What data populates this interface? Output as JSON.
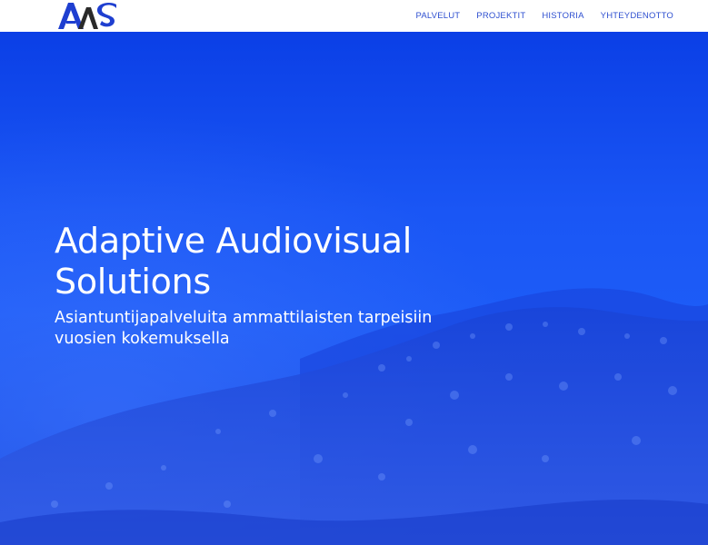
{
  "header": {
    "logo_text": "AAS",
    "nav": [
      {
        "label": "PALVELUT"
      },
      {
        "label": "PROJEKTIT"
      },
      {
        "label": "HISTORIA"
      },
      {
        "label": "YHTEYDENOTTO"
      }
    ]
  },
  "hero": {
    "title": "Adaptive Audiovisual Solutions",
    "subtitle": "Asiantuntijapalveluita ammattilaisten tarpeisiin vuosien kokemuksella"
  },
  "colors": {
    "accent": "#2e4fd0",
    "hero_blue": "#1a56f5",
    "logo_blue": "#1f3fd0",
    "logo_dark": "#222222"
  }
}
